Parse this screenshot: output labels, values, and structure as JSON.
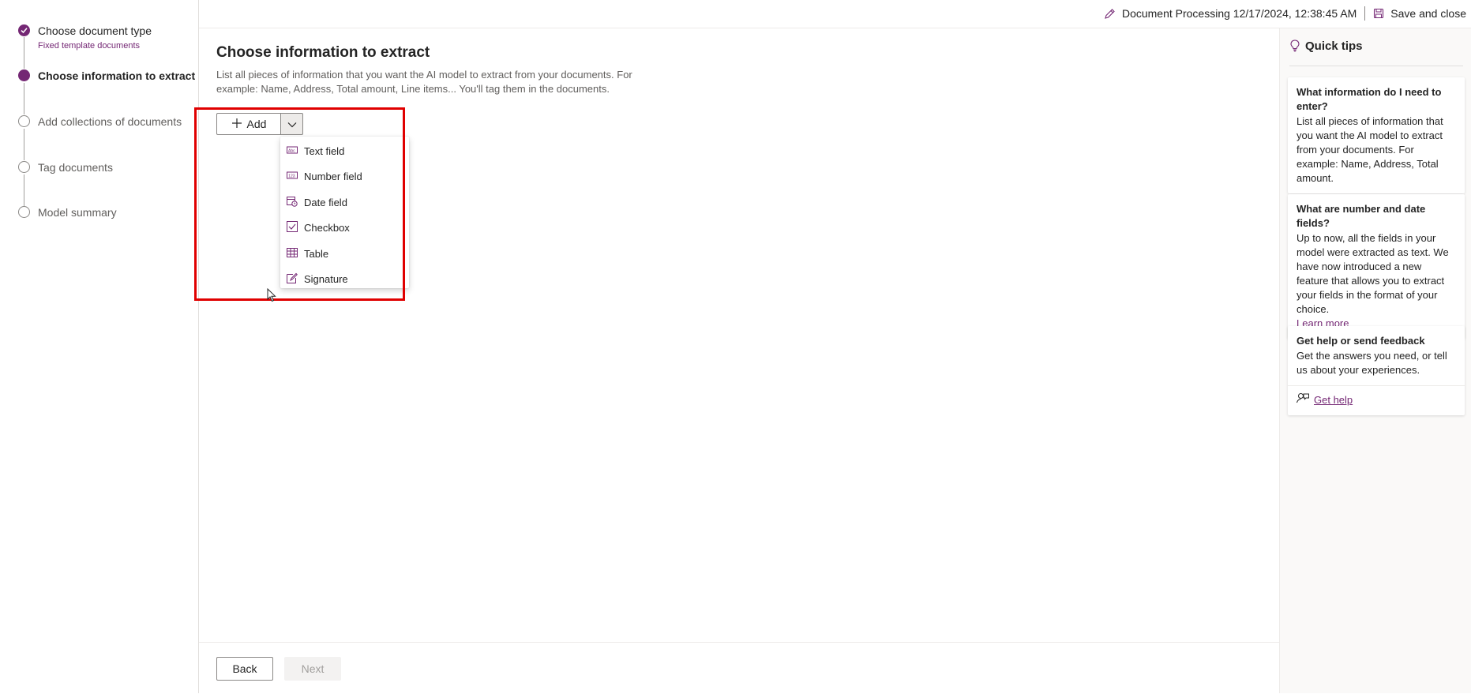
{
  "stepper": {
    "steps": [
      {
        "label": "Choose document type",
        "sub": "Fixed template documents",
        "state": "done"
      },
      {
        "label": "Choose information to extract",
        "state": "current"
      },
      {
        "label": "Add collections of documents",
        "state": "todo"
      },
      {
        "label": "Tag documents",
        "state": "todo"
      },
      {
        "label": "Model summary",
        "state": "todo"
      }
    ]
  },
  "topbar": {
    "doc_title": "Document Processing 12/17/2024, 12:38:45 AM",
    "save_close": "Save and close"
  },
  "main": {
    "title": "Choose information to extract",
    "description": "List all pieces of information that you want the AI model to extract from your documents. For example: Name, Address, Total amount, Line items... You'll tag them in the documents.",
    "add_label": "Add",
    "menu": [
      {
        "label": "Text field",
        "icon": "text-field-icon"
      },
      {
        "label": "Number field",
        "icon": "number-field-icon"
      },
      {
        "label": "Date field",
        "icon": "date-field-icon"
      },
      {
        "label": "Checkbox",
        "icon": "checkbox-icon"
      },
      {
        "label": "Table",
        "icon": "table-icon"
      },
      {
        "label": "Signature",
        "icon": "signature-icon"
      }
    ],
    "back_label": "Back",
    "next_label": "Next"
  },
  "tips": {
    "title": "Quick tips",
    "cards": [
      {
        "title": "What information do I need to enter?",
        "body": "List all pieces of information that you want the AI model to extract from your documents. For example: Name, Address, Total amount."
      },
      {
        "title": "What are number and date fields?",
        "body": "Up to now, all the fields in your model were extracted as text. We have now introduced a new feature that allows you to extract your fields in the format of your choice.",
        "link": "Learn more"
      },
      {
        "title": "Get help or send feedback",
        "body": "Get the answers you need, or tell us about your experiences.",
        "link": "Get help"
      }
    ]
  },
  "colors": {
    "accent": "#742774",
    "highlight": "#e00000"
  }
}
